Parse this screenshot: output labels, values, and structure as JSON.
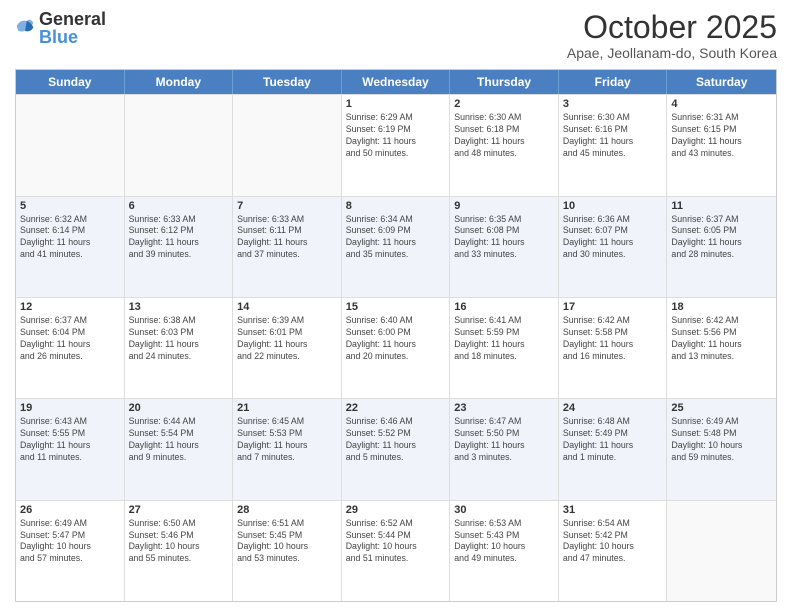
{
  "logo": {
    "general": "General",
    "blue": "Blue"
  },
  "header": {
    "title": "October 2025",
    "subtitle": "Apae, Jeollanam-do, South Korea"
  },
  "weekdays": [
    "Sunday",
    "Monday",
    "Tuesday",
    "Wednesday",
    "Thursday",
    "Friday",
    "Saturday"
  ],
  "rows": [
    {
      "alt": false,
      "cells": [
        {
          "day": "",
          "info": ""
        },
        {
          "day": "",
          "info": ""
        },
        {
          "day": "",
          "info": ""
        },
        {
          "day": "1",
          "info": "Sunrise: 6:29 AM\nSunset: 6:19 PM\nDaylight: 11 hours\nand 50 minutes."
        },
        {
          "day": "2",
          "info": "Sunrise: 6:30 AM\nSunset: 6:18 PM\nDaylight: 11 hours\nand 48 minutes."
        },
        {
          "day": "3",
          "info": "Sunrise: 6:30 AM\nSunset: 6:16 PM\nDaylight: 11 hours\nand 45 minutes."
        },
        {
          "day": "4",
          "info": "Sunrise: 6:31 AM\nSunset: 6:15 PM\nDaylight: 11 hours\nand 43 minutes."
        }
      ]
    },
    {
      "alt": true,
      "cells": [
        {
          "day": "5",
          "info": "Sunrise: 6:32 AM\nSunset: 6:14 PM\nDaylight: 11 hours\nand 41 minutes."
        },
        {
          "day": "6",
          "info": "Sunrise: 6:33 AM\nSunset: 6:12 PM\nDaylight: 11 hours\nand 39 minutes."
        },
        {
          "day": "7",
          "info": "Sunrise: 6:33 AM\nSunset: 6:11 PM\nDaylight: 11 hours\nand 37 minutes."
        },
        {
          "day": "8",
          "info": "Sunrise: 6:34 AM\nSunset: 6:09 PM\nDaylight: 11 hours\nand 35 minutes."
        },
        {
          "day": "9",
          "info": "Sunrise: 6:35 AM\nSunset: 6:08 PM\nDaylight: 11 hours\nand 33 minutes."
        },
        {
          "day": "10",
          "info": "Sunrise: 6:36 AM\nSunset: 6:07 PM\nDaylight: 11 hours\nand 30 minutes."
        },
        {
          "day": "11",
          "info": "Sunrise: 6:37 AM\nSunset: 6:05 PM\nDaylight: 11 hours\nand 28 minutes."
        }
      ]
    },
    {
      "alt": false,
      "cells": [
        {
          "day": "12",
          "info": "Sunrise: 6:37 AM\nSunset: 6:04 PM\nDaylight: 11 hours\nand 26 minutes."
        },
        {
          "day": "13",
          "info": "Sunrise: 6:38 AM\nSunset: 6:03 PM\nDaylight: 11 hours\nand 24 minutes."
        },
        {
          "day": "14",
          "info": "Sunrise: 6:39 AM\nSunset: 6:01 PM\nDaylight: 11 hours\nand 22 minutes."
        },
        {
          "day": "15",
          "info": "Sunrise: 6:40 AM\nSunset: 6:00 PM\nDaylight: 11 hours\nand 20 minutes."
        },
        {
          "day": "16",
          "info": "Sunrise: 6:41 AM\nSunset: 5:59 PM\nDaylight: 11 hours\nand 18 minutes."
        },
        {
          "day": "17",
          "info": "Sunrise: 6:42 AM\nSunset: 5:58 PM\nDaylight: 11 hours\nand 16 minutes."
        },
        {
          "day": "18",
          "info": "Sunrise: 6:42 AM\nSunset: 5:56 PM\nDaylight: 11 hours\nand 13 minutes."
        }
      ]
    },
    {
      "alt": true,
      "cells": [
        {
          "day": "19",
          "info": "Sunrise: 6:43 AM\nSunset: 5:55 PM\nDaylight: 11 hours\nand 11 minutes."
        },
        {
          "day": "20",
          "info": "Sunrise: 6:44 AM\nSunset: 5:54 PM\nDaylight: 11 hours\nand 9 minutes."
        },
        {
          "day": "21",
          "info": "Sunrise: 6:45 AM\nSunset: 5:53 PM\nDaylight: 11 hours\nand 7 minutes."
        },
        {
          "day": "22",
          "info": "Sunrise: 6:46 AM\nSunset: 5:52 PM\nDaylight: 11 hours\nand 5 minutes."
        },
        {
          "day": "23",
          "info": "Sunrise: 6:47 AM\nSunset: 5:50 PM\nDaylight: 11 hours\nand 3 minutes."
        },
        {
          "day": "24",
          "info": "Sunrise: 6:48 AM\nSunset: 5:49 PM\nDaylight: 11 hours\nand 1 minute."
        },
        {
          "day": "25",
          "info": "Sunrise: 6:49 AM\nSunset: 5:48 PM\nDaylight: 10 hours\nand 59 minutes."
        }
      ]
    },
    {
      "alt": false,
      "cells": [
        {
          "day": "26",
          "info": "Sunrise: 6:49 AM\nSunset: 5:47 PM\nDaylight: 10 hours\nand 57 minutes."
        },
        {
          "day": "27",
          "info": "Sunrise: 6:50 AM\nSunset: 5:46 PM\nDaylight: 10 hours\nand 55 minutes."
        },
        {
          "day": "28",
          "info": "Sunrise: 6:51 AM\nSunset: 5:45 PM\nDaylight: 10 hours\nand 53 minutes."
        },
        {
          "day": "29",
          "info": "Sunrise: 6:52 AM\nSunset: 5:44 PM\nDaylight: 10 hours\nand 51 minutes."
        },
        {
          "day": "30",
          "info": "Sunrise: 6:53 AM\nSunset: 5:43 PM\nDaylight: 10 hours\nand 49 minutes."
        },
        {
          "day": "31",
          "info": "Sunrise: 6:54 AM\nSunset: 5:42 PM\nDaylight: 10 hours\nand 47 minutes."
        },
        {
          "day": "",
          "info": ""
        }
      ]
    }
  ]
}
